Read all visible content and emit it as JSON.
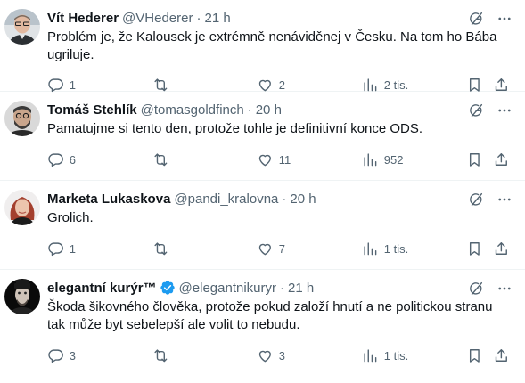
{
  "tweets": [
    {
      "name": "Vít Hederer",
      "handle": "@VHederer",
      "dot": "·",
      "time": "21 h",
      "verified": false,
      "text": "Problém je, že Kalousek je extrémně nenáviděnej v Česku. Na tom ho Bába\nugriluje.",
      "replies": "1",
      "retweets": "",
      "likes": "2",
      "views": "2 tis."
    },
    {
      "name": "Tomáš Stehlík",
      "handle": "@tomasgoldfinch",
      "dot": "·",
      "time": "20 h",
      "verified": false,
      "text": "Pamatujme si tento den, protože tohle je definitivní konce ODS.",
      "replies": "6",
      "retweets": "",
      "likes": "11",
      "views": "952"
    },
    {
      "name": "Marketa Lukaskova",
      "handle": "@pandi_kralovna",
      "dot": "·",
      "time": "20 h",
      "verified": false,
      "text": "Grolich.",
      "replies": "1",
      "retweets": "",
      "likes": "7",
      "views": "1 tis."
    },
    {
      "name": "elegantní kurýr™",
      "handle": "@elegantnikuryr",
      "dot": "·",
      "time": "21 h",
      "verified": true,
      "text": "Škoda šikovného člověka, protože pokud založí hnutí a ne politickou stranu\ntak může byt sebelepší ale volit to nebudu.",
      "replies": "3",
      "retweets": "",
      "likes": "3",
      "views": "1 tis."
    }
  ],
  "colors": {
    "text": "#0f1419",
    "secondary": "#536471",
    "divider": "#eff3f4",
    "verified": "#1d9bf0"
  },
  "icons": [
    "grok-icon",
    "more-icon",
    "reply-icon",
    "retweet-icon",
    "like-icon",
    "views-icon",
    "bookmark-icon",
    "share-icon",
    "verified-badge-icon"
  ]
}
